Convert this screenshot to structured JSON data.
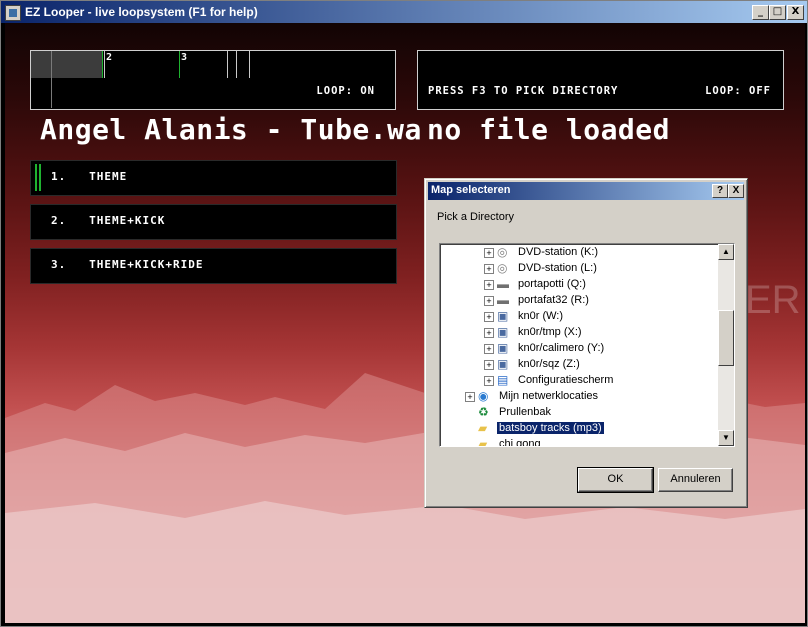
{
  "window": {
    "title": "EZ Looper - live loopsystem (F1 for help)",
    "controls": {
      "minimize": "_",
      "maximize": "□",
      "close": "X"
    }
  },
  "deck_left": {
    "markers": [
      "2",
      "3"
    ],
    "loop_status": "LOOP: ON",
    "title": "Angel Alanis - Tube.wa"
  },
  "deck_right": {
    "hint": "PRESS F3 TO PICK DIRECTORY",
    "loop_status": "LOOP: OFF",
    "title": "no file loaded"
  },
  "segments": [
    {
      "label": "1.   THEME",
      "active": true
    },
    {
      "label": "2.   THEME+KICK",
      "active": false
    },
    {
      "label": "3.   THEME+KICK+RIDE",
      "active": false
    }
  ],
  "background_text": "ER",
  "dialog": {
    "title": "Map selecteren",
    "help": "?",
    "close": "X",
    "prompt": "Pick a Directory",
    "items": [
      {
        "label": "DVD-station (K:)",
        "icon": "cd-drive-icon",
        "indent": 2,
        "expander": "+",
        "selected": false
      },
      {
        "label": "DVD-station (L:)",
        "icon": "cd-drive-icon",
        "indent": 2,
        "expander": "+",
        "selected": false
      },
      {
        "label": "portapotti (Q:)",
        "icon": "disk-drive-icon",
        "indent": 2,
        "expander": "+",
        "selected": false
      },
      {
        "label": "portafat32 (R:)",
        "icon": "disk-drive-icon",
        "indent": 2,
        "expander": "+",
        "selected": false
      },
      {
        "label": "kn0r (W:)",
        "icon": "network-drive-icon",
        "indent": 2,
        "expander": "+",
        "selected": false
      },
      {
        "label": "kn0r/tmp (X:)",
        "icon": "network-drive-icon",
        "indent": 2,
        "expander": "+",
        "selected": false
      },
      {
        "label": "kn0r/calimero (Y:)",
        "icon": "network-drive-icon",
        "indent": 2,
        "expander": "+",
        "selected": false
      },
      {
        "label": "kn0r/sqz (Z:)",
        "icon": "network-drive-icon",
        "indent": 2,
        "expander": "+",
        "selected": false
      },
      {
        "label": "Configuratiescherm",
        "icon": "control-panel-icon",
        "indent": 2,
        "expander": "+",
        "selected": false
      },
      {
        "label": "Mijn netwerklocaties",
        "icon": "network-places-icon",
        "indent": 1,
        "expander": "+",
        "selected": false
      },
      {
        "label": "Prullenbak",
        "icon": "recycle-bin-icon",
        "indent": 1,
        "expander": "",
        "selected": false
      },
      {
        "label": "batsboy tracks (mp3)",
        "icon": "folder-icon",
        "indent": 1,
        "expander": "",
        "selected": true
      },
      {
        "label": "chi gong",
        "icon": "folder-icon",
        "indent": 1,
        "expander": "",
        "selected": false
      }
    ],
    "ok_label": "OK",
    "cancel_label": "Annuleren"
  }
}
